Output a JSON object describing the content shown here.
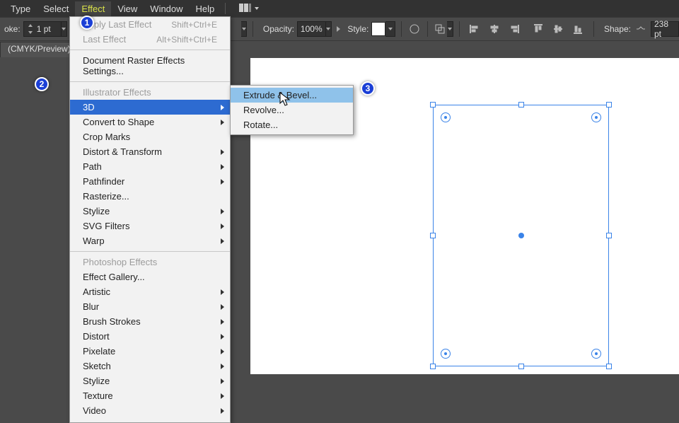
{
  "menubar": {
    "items": [
      "Type",
      "Select",
      "Effect",
      "View",
      "Window",
      "Help"
    ]
  },
  "optionsbar": {
    "stroke_label": "oke:",
    "stroke_value": "1 pt",
    "opacity_label": "Opacity:",
    "opacity_value": "100%",
    "style_label": "Style:",
    "shape_label": "Shape:",
    "shape_value": "238 pt"
  },
  "document_tab": "(CMYK/Preview)",
  "effect_menu": {
    "apply_last": "Apply Last Effect",
    "apply_last_sc": "Shift+Ctrl+E",
    "last": "Last Effect",
    "last_sc": "Alt+Shift+Ctrl+E",
    "raster_settings": "Document Raster Effects Settings...",
    "section_ill": "Illustrator Effects",
    "threeD": "3D",
    "convert_shape": "Convert to Shape",
    "crop_marks": "Crop Marks",
    "distort_transform": "Distort & Transform",
    "path": "Path",
    "pathfinder": "Pathfinder",
    "rasterize": "Rasterize...",
    "stylize": "Stylize",
    "svg_filters": "SVG Filters",
    "warp": "Warp",
    "section_ps": "Photoshop Effects",
    "fx_gallery": "Effect Gallery...",
    "artistic": "Artistic",
    "blur": "Blur",
    "brush": "Brush Strokes",
    "distort": "Distort",
    "pixelate": "Pixelate",
    "sketch": "Sketch",
    "stylize2": "Stylize",
    "texture": "Texture",
    "video": "Video"
  },
  "submenu_3d": {
    "extrude": "Extrude & Bevel...",
    "revolve": "Revolve...",
    "rotate": "Rotate..."
  },
  "steps": {
    "s1": "1",
    "s2": "2",
    "s3": "3"
  }
}
